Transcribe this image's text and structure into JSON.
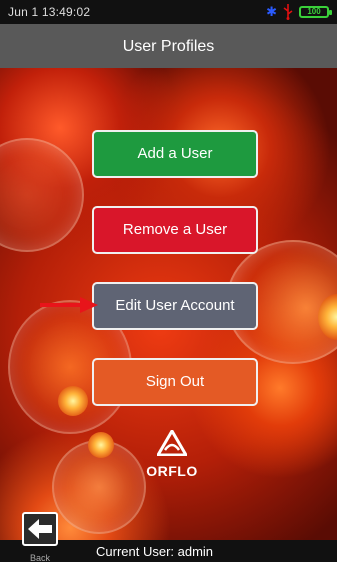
{
  "status": {
    "time": "Jun 1 13:49:02",
    "battery_label": "100",
    "icons": [
      "bluetooth-icon",
      "usb-icon",
      "battery-icon"
    ],
    "colors": {
      "bluetooth": "#2a5bff",
      "usb": "#e01010",
      "battery": "#3ad13a"
    }
  },
  "header": {
    "title": "User Profiles"
  },
  "menu": {
    "add_label": "Add a User",
    "remove_label": "Remove a User",
    "edit_label": "Edit User Account",
    "signout_label": "Sign Out",
    "colors": {
      "add": "#1e9a3f",
      "remove": "#d9162a",
      "edit": "#5f6474",
      "signout": "#e45a25"
    }
  },
  "logo": {
    "text": "ORFLO"
  },
  "footer": {
    "back_label": "Back",
    "current_user": "Current User: admin"
  }
}
